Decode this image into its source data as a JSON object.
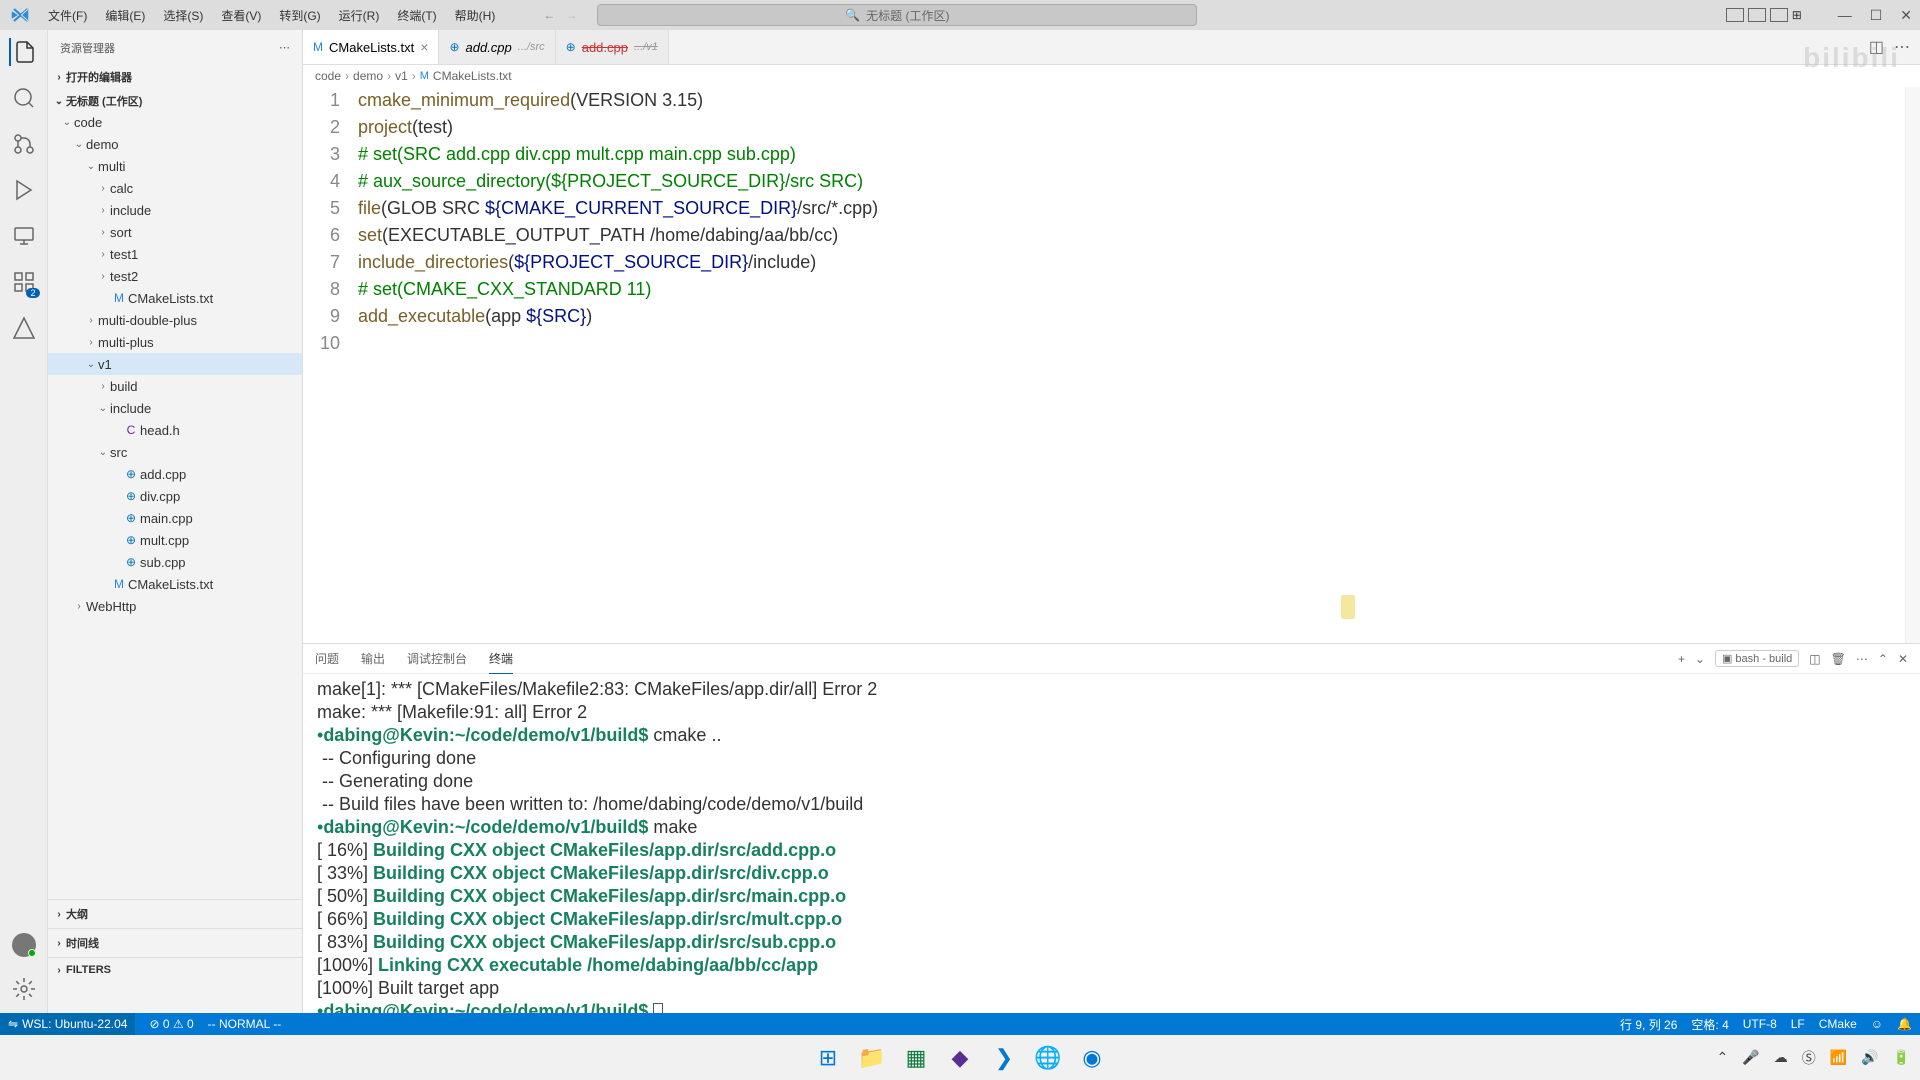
{
  "menu": {
    "file": "文件(F)",
    "edit": "编辑(E)",
    "select": "选择(S)",
    "view": "查看(V)",
    "go": "转到(G)",
    "run": "运行(R)",
    "terminal": "终端(T)",
    "help": "帮助(H)"
  },
  "search_placeholder": "无标题 (工作区)",
  "sidebar": {
    "title": "资源管理器",
    "open_editors": "打开的编辑器",
    "workspace": "无标题 (工作区)",
    "outline": "大纲",
    "timeline": "时间线",
    "filters": "FILTERS"
  },
  "tree": {
    "code": "code",
    "demo": "demo",
    "multi": "multi",
    "calc": "calc",
    "include": "include",
    "sort": "sort",
    "test1": "test1",
    "test2": "test2",
    "cmakelists": "CMakeLists.txt",
    "multi_double_plus": "multi-double-plus",
    "multi_plus": "multi-plus",
    "v1": "v1",
    "build": "build",
    "include2": "include",
    "head_h": "head.h",
    "src": "src",
    "add_cpp": "add.cpp",
    "div_cpp": "div.cpp",
    "main_cpp": "main.cpp",
    "mult_cpp": "mult.cpp",
    "sub_cpp": "sub.cpp",
    "cmakelists2": "CMakeLists.txt",
    "webhttp": "WebHttp"
  },
  "tabs": {
    "t1": "CMakeLists.txt",
    "t2": "add.cpp",
    "t2_desc": ".../src",
    "t3": "add.cpp",
    "t3_desc": ".../v1"
  },
  "breadcrumb": {
    "p1": "code",
    "p2": "demo",
    "p3": "v1",
    "p4": "CMakeLists.txt"
  },
  "code_lines": [
    {
      "n": "1",
      "html": "<span class='fn'>cmake_minimum_required</span>(VERSION 3.15)"
    },
    {
      "n": "2",
      "html": "<span class='fn'>project</span>(test)"
    },
    {
      "n": "3",
      "html": "<span class='cmt'># set(SRC add.cpp div.cpp mult.cpp main.cpp sub.cpp)</span>"
    },
    {
      "n": "4",
      "html": "<span class='cmt'># aux_source_directory(${PROJECT_SOURCE_DIR}/src SRC)</span>"
    },
    {
      "n": "5",
      "html": "<span class='fn'>file</span>(GLOB SRC <span class='var'>${CMAKE_CURRENT_SOURCE_DIR}</span>/src/*.cpp)"
    },
    {
      "n": "6",
      "html": "<span class='fn'>set</span>(EXECUTABLE_OUTPUT_PATH /home/dabing/aa/bb/cc)"
    },
    {
      "n": "7",
      "html": "<span class='fn'>include_directories</span>(<span class='var'>${PROJECT_SOURCE_DIR}</span>/include)"
    },
    {
      "n": "8",
      "html": "<span class='cmt'># set(CMAKE_CXX_STANDARD 11)</span>"
    },
    {
      "n": "9",
      "html": "<span class='fn'>add_executable</span>(app <span class='var'>${SRC}</span>)"
    },
    {
      "n": "10",
      "html": ""
    }
  ],
  "panel": {
    "problems": "问题",
    "output": "输出",
    "debug": "调试控制台",
    "terminal": "终端",
    "term_label": "bash - build"
  },
  "terminal_lines": [
    {
      "cls": "err",
      "text": "make[1]: *** [CMakeFiles/Makefile2:83: CMakeFiles/app.dir/all] Error 2"
    },
    {
      "cls": "err",
      "text": "make: *** [Makefile:91: all] Error 2"
    },
    {
      "cls": "prompt",
      "text": "dabing@Kevin:~/code/demo/v1/build$",
      "after": " cmake .."
    },
    {
      "cls": "",
      "text": " -- Configuring done"
    },
    {
      "cls": "",
      "text": " -- Generating done"
    },
    {
      "cls": "",
      "text": " -- Build files have been written to: /home/dabing/code/demo/v1/build"
    },
    {
      "cls": "prompt",
      "text": "dabing@Kevin:~/code/demo/v1/build$",
      "after": " make"
    },
    {
      "cls": "",
      "text": "[ 16%] ",
      "build": "Building CXX object CMakeFiles/app.dir/src/add.cpp.o"
    },
    {
      "cls": "",
      "text": "[ 33%] ",
      "build": "Building CXX object CMakeFiles/app.dir/src/div.cpp.o"
    },
    {
      "cls": "",
      "text": "[ 50%] ",
      "build": "Building CXX object CMakeFiles/app.dir/src/main.cpp.o"
    },
    {
      "cls": "",
      "text": "[ 66%] ",
      "build": "Building CXX object CMakeFiles/app.dir/src/mult.cpp.o"
    },
    {
      "cls": "",
      "text": "[ 83%] ",
      "build": "Building CXX object CMakeFiles/app.dir/src/sub.cpp.o"
    },
    {
      "cls": "",
      "text": "[100%] ",
      "build": "Linking CXX executable /home/dabing/aa/bb/cc/app"
    },
    {
      "cls": "",
      "text": "[100%] Built target app"
    },
    {
      "cls": "prompt",
      "text": "dabing@Kevin:~/code/demo/v1/build$",
      "cursor": true
    }
  ],
  "status": {
    "remote": "WSL: Ubuntu-22.04",
    "errors": "⊘ 0 ⚠ 0",
    "mode": "-- NORMAL --",
    "pos": "行 9, 列 26",
    "spaces": "空格: 4",
    "encoding": "UTF-8",
    "eol": "LF",
    "lang": "CMake"
  },
  "ext_badge": "2"
}
